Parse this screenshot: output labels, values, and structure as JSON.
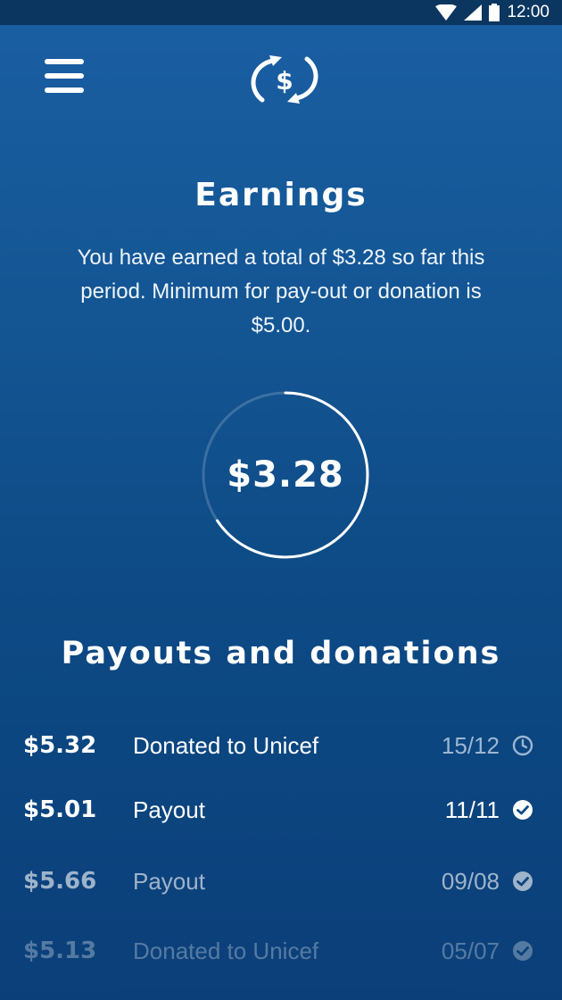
{
  "status_bar": {
    "time": "12:00"
  },
  "header": {
    "menu_icon": "hamburger-menu-icon",
    "logo_icon": "dollar-exchange-logo-icon"
  },
  "earnings": {
    "title": "Earnings",
    "description": "You have earned a total of $3.28 so far this period. Minimum for pay-out or donation is $5.00.",
    "amount": "$3.28",
    "progress_fraction": 0.656
  },
  "payouts": {
    "title": "Payouts and donations",
    "items": [
      {
        "amount": "$5.32",
        "description": "Donated to Unicef",
        "date": "15/12",
        "status_icon": "clock-icon"
      },
      {
        "amount": "$5.01",
        "description": "Payout",
        "date": "11/11",
        "status_icon": "check-circle-icon"
      },
      {
        "amount": "$5.66",
        "description": "Payout",
        "date": "09/08",
        "status_icon": "check-circle-icon"
      },
      {
        "amount": "$5.13",
        "description": "Donated to Unicef",
        "date": "05/07",
        "status_icon": "check-circle-icon"
      }
    ]
  },
  "colors": {
    "background_top": "#1a5fa3",
    "background_bottom": "#0b3f79",
    "status_bar": "#0a3660",
    "text": "#ffffff"
  }
}
